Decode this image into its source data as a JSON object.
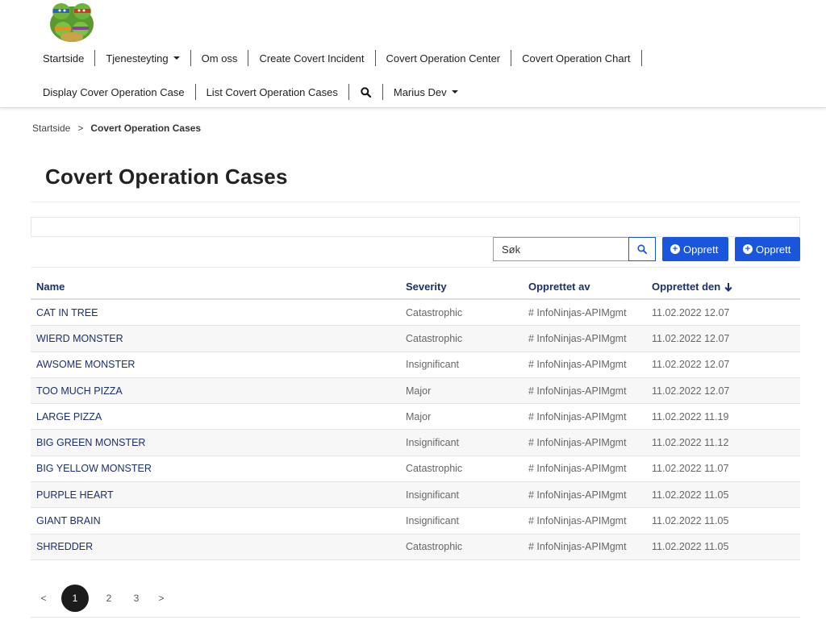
{
  "header": {
    "logo": "turtle-mascot-logo",
    "nav_row1": [
      {
        "label": "Startside",
        "dropdown": false
      },
      {
        "label": "Tjenesteyting",
        "dropdown": true
      },
      {
        "label": "Om oss",
        "dropdown": false
      },
      {
        "label": "Create Covert Incident",
        "dropdown": false
      },
      {
        "label": "Covert Operation Center",
        "dropdown": false
      },
      {
        "label": "Covert Operation Chart",
        "dropdown": false
      }
    ],
    "nav_row2": [
      {
        "label": "Display Cover Operation Case",
        "dropdown": false
      },
      {
        "label": "List Covert Operation Cases",
        "dropdown": false
      }
    ],
    "user_menu": "Marius Dev"
  },
  "breadcrumb": {
    "home": "Startside",
    "separator": ">",
    "current": "Covert Operation Cases"
  },
  "page": {
    "title": "Covert Operation Cases"
  },
  "toolbar": {
    "search_placeholder": "Søk",
    "create_label_1": "Opprett",
    "create_label_2": "Opprett"
  },
  "table": {
    "headers": {
      "name": "Name",
      "severity": "Severity",
      "created_by": "Opprettet av",
      "created_on": "Opprettet den"
    },
    "sort": {
      "column": "created_on",
      "direction": "desc"
    },
    "rows": [
      {
        "name": "CAT IN TREE",
        "severity": "Catastrophic",
        "created_by": "# InfoNinjas-APIMgmt",
        "created_on": "11.02.2022 12.07"
      },
      {
        "name": "WIERD MONSTER",
        "severity": "Catastrophic",
        "created_by": "# InfoNinjas-APIMgmt",
        "created_on": "11.02.2022 12.07"
      },
      {
        "name": "AWSOME MONSTER",
        "severity": "Insignificant",
        "created_by": "# InfoNinjas-APIMgmt",
        "created_on": "11.02.2022 12.07"
      },
      {
        "name": "TOO MUCH PIZZA",
        "severity": "Major",
        "created_by": "# InfoNinjas-APIMgmt",
        "created_on": "11.02.2022 12.07"
      },
      {
        "name": "LARGE PIZZA",
        "severity": "Major",
        "created_by": "# InfoNinjas-APIMgmt",
        "created_on": "11.02.2022 11.19"
      },
      {
        "name": "BIG GREEN MONSTER",
        "severity": "Insignificant",
        "created_by": "# InfoNinjas-APIMgmt",
        "created_on": "11.02.2022 11.12"
      },
      {
        "name": "BIG YELLOW MONSTER",
        "severity": "Catastrophic",
        "created_by": "# InfoNinjas-APIMgmt",
        "created_on": "11.02.2022 11.07"
      },
      {
        "name": "PURPLE HEART",
        "severity": "Insignificant",
        "created_by": "# InfoNinjas-APIMgmt",
        "created_on": "11.02.2022 11.05"
      },
      {
        "name": "GIANT BRAIN",
        "severity": "Insignificant",
        "created_by": "# InfoNinjas-APIMgmt",
        "created_on": "11.02.2022 11.05"
      },
      {
        "name": "SHREDDER",
        "severity": "Catastrophic",
        "created_by": "# InfoNinjas-APIMgmt",
        "created_on": "11.02.2022 11.05"
      }
    ]
  },
  "pagination": {
    "prev": "<",
    "next": ">",
    "pages": [
      "1",
      "2",
      "3"
    ],
    "current": "1"
  },
  "colors": {
    "primary": "#1a56db",
    "link": "#1c2f6e",
    "active_page": "#1b1b1b"
  }
}
